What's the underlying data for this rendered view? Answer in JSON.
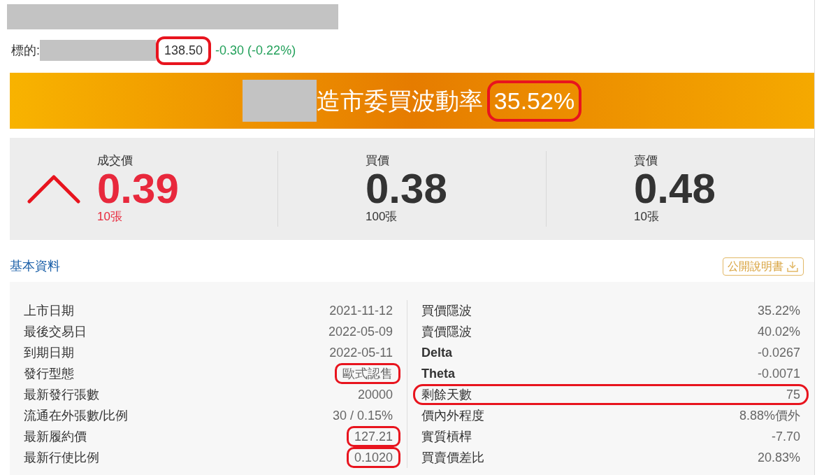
{
  "underlying": {
    "label": "標的:",
    "price": "138.50",
    "price_highlighted": true,
    "change": "-0.30 (-0.22%)",
    "falling": true
  },
  "banner": {
    "title": "造市委買波動率",
    "value": "35.52%",
    "value_highlighted": true
  },
  "quotes": [
    {
      "label": "成交價",
      "value": "0.39",
      "volume": "10張",
      "rising": true
    },
    {
      "label": "買價",
      "value": "0.38",
      "volume": "100張",
      "rising": false
    },
    {
      "label": "賣價",
      "value": "0.48",
      "volume": "10張",
      "rising": false
    }
  ],
  "section": {
    "title": "基本資料",
    "prospectus_button": "公開說明書"
  },
  "details_left": [
    {
      "label": "上市日期",
      "value": "2021-11-12",
      "bold": false,
      "row_circled": false,
      "value_circled": false
    },
    {
      "label": "最後交易日",
      "value": "2022-05-09",
      "bold": false,
      "row_circled": false,
      "value_circled": false
    },
    {
      "label": "到期日期",
      "value": "2022-05-11",
      "bold": false,
      "row_circled": false,
      "value_circled": false
    },
    {
      "label": "發行型態",
      "value": "歐式認售",
      "bold": false,
      "row_circled": false,
      "value_circled": true
    },
    {
      "label": "最新發行張數",
      "value": "20000",
      "bold": false,
      "row_circled": false,
      "value_circled": false
    },
    {
      "label": "流通在外張數/比例",
      "value": "30 / 0.15%",
      "bold": false,
      "row_circled": false,
      "value_circled": false
    },
    {
      "label": "最新履約價",
      "value": "127.21",
      "bold": false,
      "row_circled": false,
      "value_circled": true
    },
    {
      "label": "最新行使比例",
      "value": "0.1020",
      "bold": false,
      "row_circled": false,
      "value_circled": true
    }
  ],
  "details_right": [
    {
      "label": "買價隱波",
      "value": "35.22%",
      "bold": false,
      "row_circled": false,
      "value_circled": false
    },
    {
      "label": "賣價隱波",
      "value": "40.02%",
      "bold": false,
      "row_circled": false,
      "value_circled": false
    },
    {
      "label": "Delta",
      "value": "-0.0267",
      "bold": true,
      "row_circled": false,
      "value_circled": false
    },
    {
      "label": "Theta",
      "value": "-0.0071",
      "bold": true,
      "row_circled": false,
      "value_circled": false
    },
    {
      "label": "剩餘天數",
      "value": "75",
      "bold": false,
      "row_circled": true,
      "value_circled": false
    },
    {
      "label": "價內外程度",
      "value": "8.88%價外",
      "bold": false,
      "row_circled": false,
      "value_circled": false
    },
    {
      "label": "實質槓桿",
      "value": "-7.70",
      "bold": false,
      "row_circled": false,
      "value_circled": false
    },
    {
      "label": "買賣價差比",
      "value": "20.83%",
      "bold": false,
      "row_circled": false,
      "value_circled": false
    }
  ]
}
